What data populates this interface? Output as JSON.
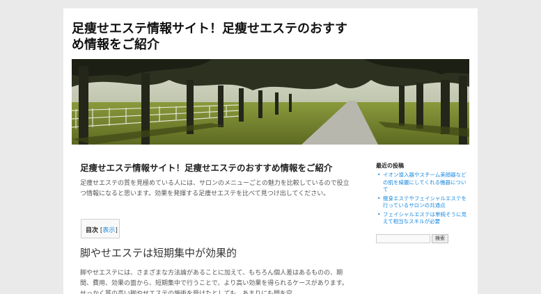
{
  "site": {
    "title_line1": "足痩せエステ情報サイト！足痩せエステのおすす",
    "title_line2": "め情報をご紹介"
  },
  "article": {
    "title": "足痩せエステ情報サイト！足痩せエステのおすすめ情報をご紹介",
    "intro": "足痩せエステの質を見極めている人には、サロンのメニューごとの魅力を比較しているので役立つ情報になると思います。効果を発揮する足痩せエステを比べて見つけ出してください。",
    "toc": {
      "title": "目次",
      "open_bracket": "[",
      "toggle": "表示",
      "close_bracket": "]"
    },
    "section_heading": "脚やせエステは短期集中が効果的",
    "section_text": "脚やせエステには、さまざまな方法論があることに加えて、もちろん個人差はあるものの、期間、費用、効果の面から、短期集中で行うことで、より高い効果を得られるケースがあります。せっかく質の高い脚やせエステの施術を受けたとしても、あまりにも間を空"
  },
  "sidebar": {
    "recent_title": "最近の投稿",
    "recent_posts": [
      "イオン導入器やスチーム美顔器などの肌を綺麗にしてくれる機器について",
      "痩身エステやフェイシャルエステを行っているサロンの共通点",
      "フェイシャルエステは単純そうに見えて相当なスキルが必要"
    ],
    "search_placeholder": "",
    "search_button": "検索"
  }
}
